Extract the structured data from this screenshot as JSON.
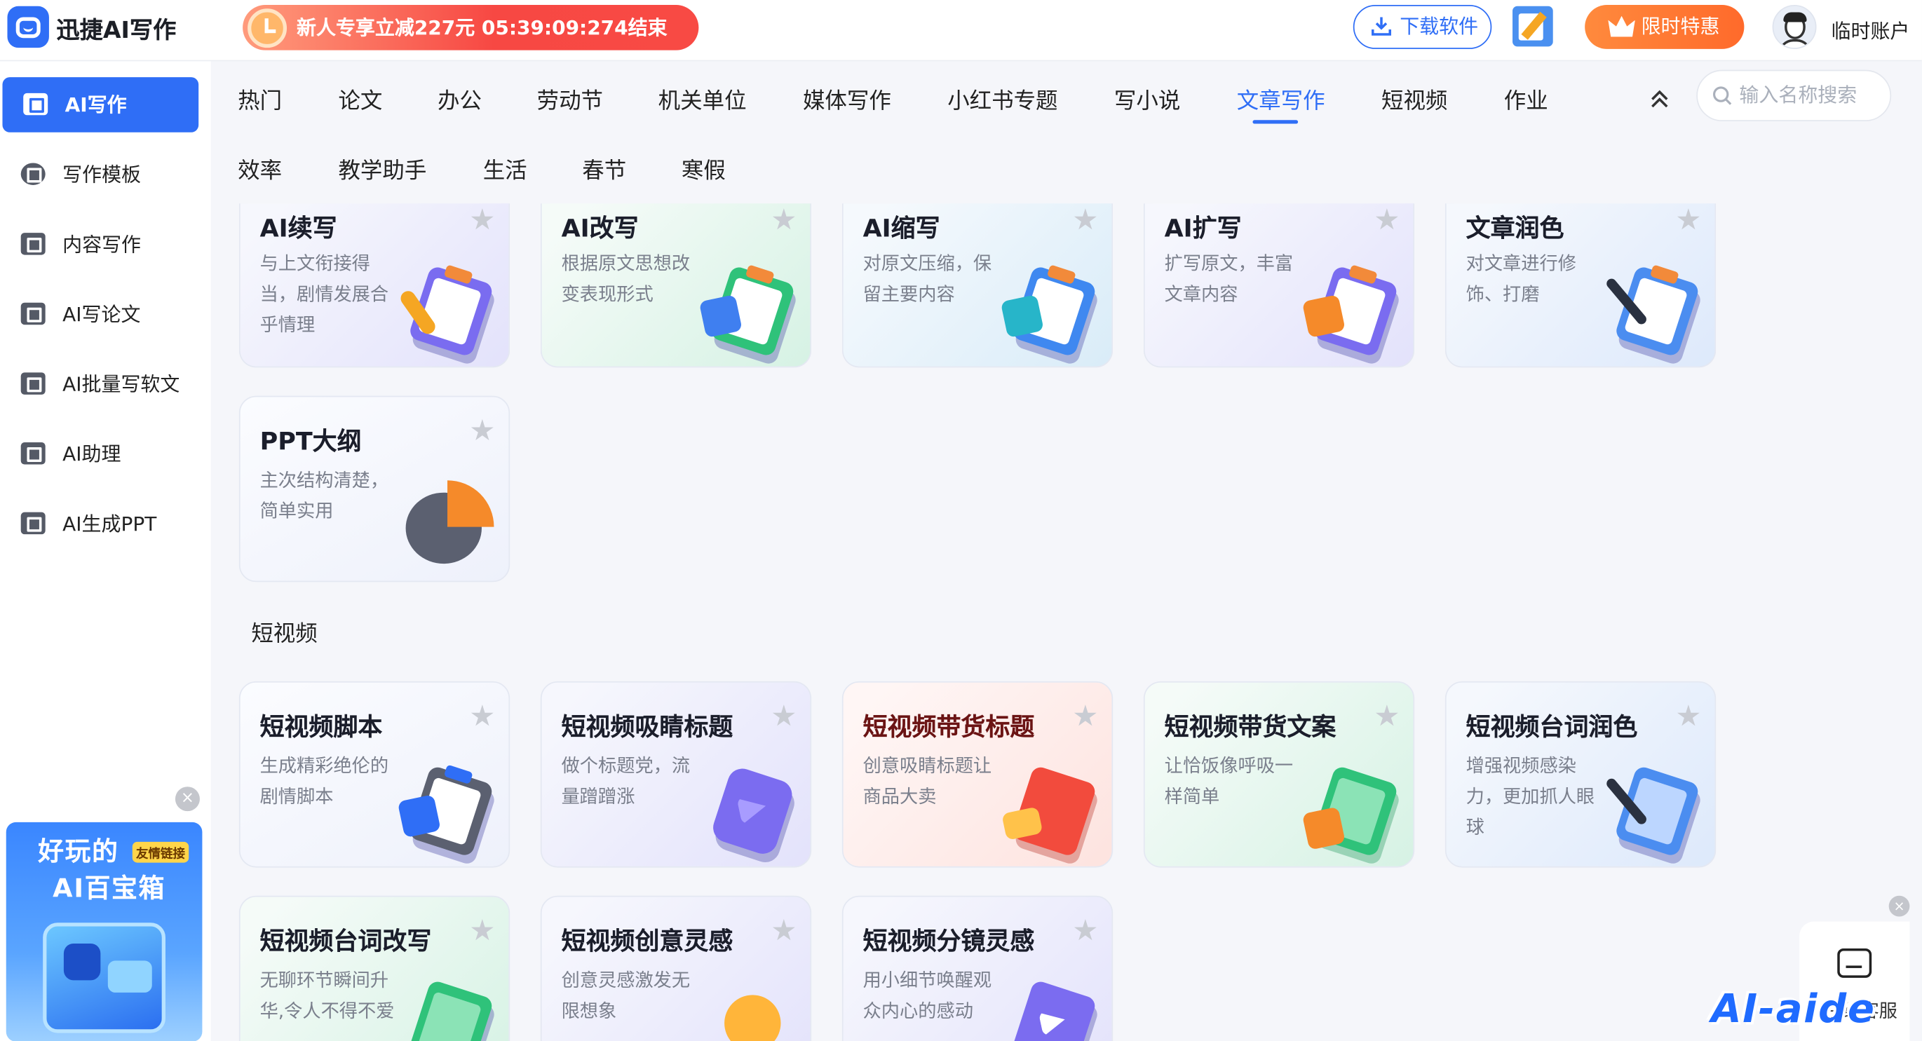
{
  "header": {
    "brand": "迅捷AI写作",
    "promo": "新人专享立减227元 05:39:09:274结束",
    "download_label": "下载软件",
    "vip_label": "限时特惠",
    "user_label": "临时账户"
  },
  "sidebar": {
    "items": [
      {
        "label": "AI写作",
        "active": true
      },
      {
        "label": "写作模板"
      },
      {
        "label": "内容写作"
      },
      {
        "label": "AI写论文"
      },
      {
        "label": "AI批量写软文"
      },
      {
        "label": "AI助理"
      },
      {
        "label": "AI生成PPT"
      }
    ],
    "banner": {
      "line1": "好玩的",
      "line2": "AI百宝箱",
      "tag": "友情链接"
    }
  },
  "tabs": {
    "row1": [
      "热门",
      "论文",
      "办公",
      "劳动节",
      "机关单位",
      "媒体写作",
      "小红书专题",
      "写小说",
      "文章写作",
      "短视频",
      "作业"
    ],
    "row2": [
      "效率",
      "教学助手",
      "生活",
      "春节",
      "寒假"
    ],
    "active": "文章写作",
    "search_placeholder": "输入名称搜索"
  },
  "cards_article": [
    {
      "title": "AI续写",
      "desc": "与上文衔接得当，剧情发展合乎情理",
      "theme": "purple",
      "accent": "#f5a623"
    },
    {
      "title": "AI改写",
      "desc": "根据原文思想改变表现形式",
      "theme": "green",
      "accent": "#2fc27a"
    },
    {
      "title": "AI缩写",
      "desc": "对原文压缩，保留主要内容",
      "theme": "teal",
      "accent": "#27b5c9"
    },
    {
      "title": "AI扩写",
      "desc": "扩写原文，丰富文章内容",
      "theme": "purple",
      "accent": "#f58a2a"
    },
    {
      "title": "文章润色",
      "desc": "对文章进行修饰、打磨",
      "theme": "blue",
      "accent": "#4b8df0"
    },
    {
      "title": "PPT大纲",
      "desc": "主次结构清楚，简单实用",
      "theme": "default",
      "accent": "#f58a2a"
    }
  ],
  "section_video": "短视频",
  "cards_video": [
    {
      "title": "短视频脚本",
      "desc": "生成精彩绝伦的剧情脚本",
      "theme": "default",
      "accent": "#2f6ef6"
    },
    {
      "title": "短视频吸睛标题",
      "desc": "做个标题党，流量蹭蹭涨",
      "theme": "purple",
      "accent": "#7b6cf0"
    },
    {
      "title": "短视频带货标题",
      "desc": "创意吸睛标题让商品大卖",
      "theme": "red",
      "accent": "#f24b3d"
    },
    {
      "title": "短视频带货文案",
      "desc": "让恰饭像呼吸一样简单",
      "theme": "green",
      "accent": "#2fc27a"
    },
    {
      "title": "短视频台词润色",
      "desc": "增强视频感染力，更加抓人眼球",
      "theme": "blue",
      "accent": "#4b8df0"
    },
    {
      "title": "短视频台词改写",
      "desc": "无聊环节瞬间升华,令人不得不爱",
      "theme": "green",
      "accent": "#2fc27a"
    },
    {
      "title": "短视频创意灵感",
      "desc": "创意灵感激发无限想象",
      "theme": "purple",
      "accent": "#f5a623"
    },
    {
      "title": "短视频分镜灵感",
      "desc": "用小细节唤醒观众内心的感动",
      "theme": "purple",
      "accent": "#7b6cf0"
    }
  ],
  "service": {
    "label": "在线客服"
  },
  "watermark": "AI-aide"
}
